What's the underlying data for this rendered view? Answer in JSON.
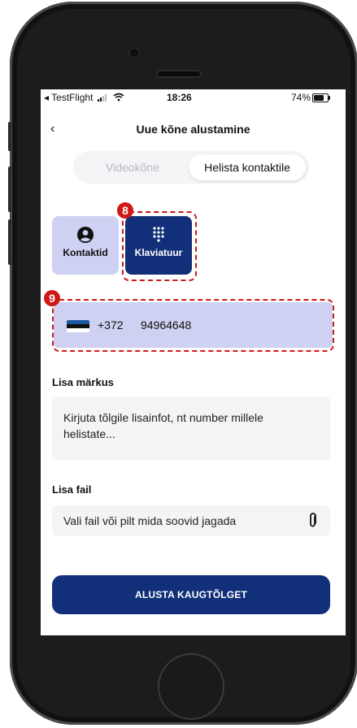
{
  "status_bar": {
    "carrier": "◂ TestFlight",
    "time": "18:26",
    "battery_pct": "74%",
    "battery_level": 0.74
  },
  "header": {
    "back_icon": "chevron-left-icon",
    "back_glyph": "‹",
    "title": "Uue kõne alustamine"
  },
  "mode_toggle": {
    "options": [
      "Videokõne",
      "Helista kontaktile"
    ],
    "selected": "Helista kontaktile"
  },
  "input_tabs": {
    "contacts": {
      "label": "Kontaktid",
      "icon": "person-circle-icon"
    },
    "keypad": {
      "label": "Klaviatuur",
      "icon": "dialpad-icon",
      "selected": true
    }
  },
  "annotations": {
    "step_keypad": "8",
    "step_phone": "9",
    "color": "#d01818"
  },
  "phone_field": {
    "country_code": "+372",
    "number": "94964648",
    "flag_icon": "estonia-flag-icon",
    "flag_colors": [
      "#1c5aa0",
      "#111111",
      "#ffffff"
    ]
  },
  "note": {
    "label": "Lisa märkus",
    "placeholder": "Kirjuta tõlgile lisainfot, nt number millele helistate..."
  },
  "attachment": {
    "label": "Lisa fail",
    "placeholder": "Vali fail või pilt mida soovid jagada",
    "icon": "paperclip-icon"
  },
  "cta": {
    "label": "ALUSTA KAUGTÕLGET"
  },
  "colors": {
    "primary": "#12307a",
    "light_accent": "#ced1f1",
    "field_bg": "#f4f4f6"
  }
}
